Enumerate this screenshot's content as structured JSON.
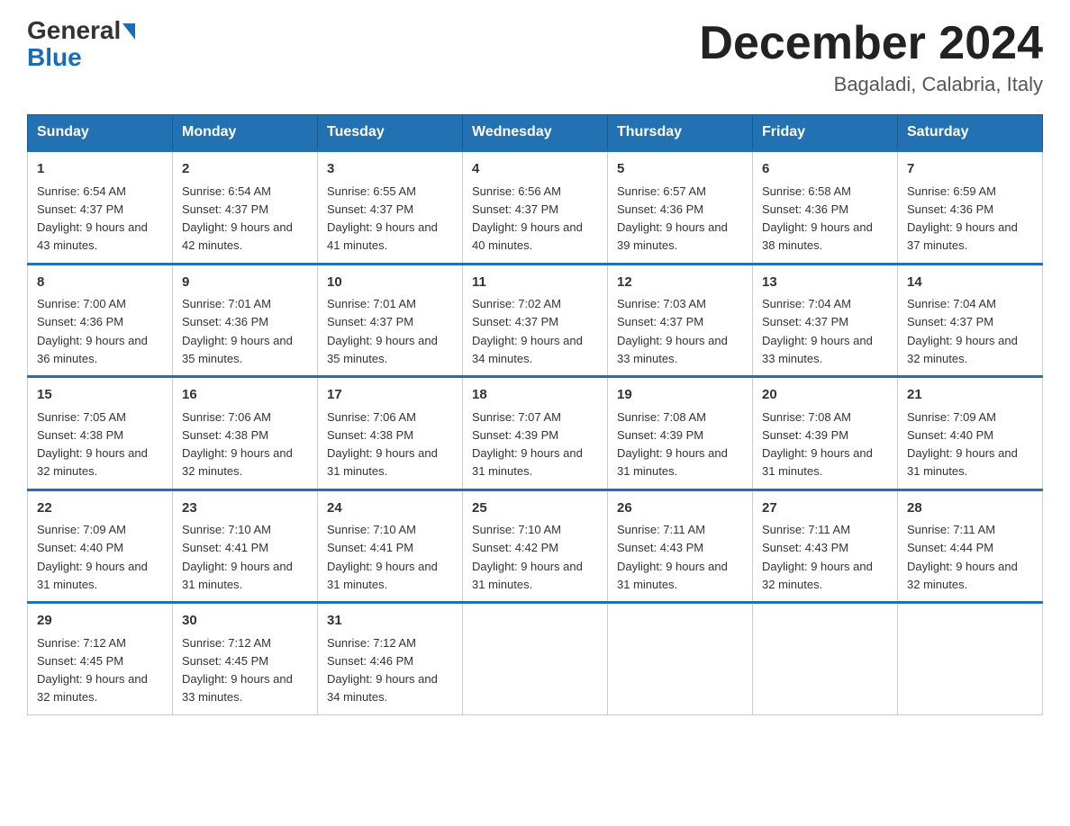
{
  "header": {
    "logo_general": "General",
    "logo_blue": "Blue",
    "title": "December 2024",
    "location": "Bagaladi, Calabria, Italy"
  },
  "days_of_week": [
    "Sunday",
    "Monday",
    "Tuesday",
    "Wednesday",
    "Thursday",
    "Friday",
    "Saturday"
  ],
  "weeks": [
    [
      {
        "day": "1",
        "sunrise": "6:54 AM",
        "sunset": "4:37 PM",
        "daylight": "9 hours and 43 minutes."
      },
      {
        "day": "2",
        "sunrise": "6:54 AM",
        "sunset": "4:37 PM",
        "daylight": "9 hours and 42 minutes."
      },
      {
        "day": "3",
        "sunrise": "6:55 AM",
        "sunset": "4:37 PM",
        "daylight": "9 hours and 41 minutes."
      },
      {
        "day": "4",
        "sunrise": "6:56 AM",
        "sunset": "4:37 PM",
        "daylight": "9 hours and 40 minutes."
      },
      {
        "day": "5",
        "sunrise": "6:57 AM",
        "sunset": "4:36 PM",
        "daylight": "9 hours and 39 minutes."
      },
      {
        "day": "6",
        "sunrise": "6:58 AM",
        "sunset": "4:36 PM",
        "daylight": "9 hours and 38 minutes."
      },
      {
        "day": "7",
        "sunrise": "6:59 AM",
        "sunset": "4:36 PM",
        "daylight": "9 hours and 37 minutes."
      }
    ],
    [
      {
        "day": "8",
        "sunrise": "7:00 AM",
        "sunset": "4:36 PM",
        "daylight": "9 hours and 36 minutes."
      },
      {
        "day": "9",
        "sunrise": "7:01 AM",
        "sunset": "4:36 PM",
        "daylight": "9 hours and 35 minutes."
      },
      {
        "day": "10",
        "sunrise": "7:01 AM",
        "sunset": "4:37 PM",
        "daylight": "9 hours and 35 minutes."
      },
      {
        "day": "11",
        "sunrise": "7:02 AM",
        "sunset": "4:37 PM",
        "daylight": "9 hours and 34 minutes."
      },
      {
        "day": "12",
        "sunrise": "7:03 AM",
        "sunset": "4:37 PM",
        "daylight": "9 hours and 33 minutes."
      },
      {
        "day": "13",
        "sunrise": "7:04 AM",
        "sunset": "4:37 PM",
        "daylight": "9 hours and 33 minutes."
      },
      {
        "day": "14",
        "sunrise": "7:04 AM",
        "sunset": "4:37 PM",
        "daylight": "9 hours and 32 minutes."
      }
    ],
    [
      {
        "day": "15",
        "sunrise": "7:05 AM",
        "sunset": "4:38 PM",
        "daylight": "9 hours and 32 minutes."
      },
      {
        "day": "16",
        "sunrise": "7:06 AM",
        "sunset": "4:38 PM",
        "daylight": "9 hours and 32 minutes."
      },
      {
        "day": "17",
        "sunrise": "7:06 AM",
        "sunset": "4:38 PM",
        "daylight": "9 hours and 31 minutes."
      },
      {
        "day": "18",
        "sunrise": "7:07 AM",
        "sunset": "4:39 PM",
        "daylight": "9 hours and 31 minutes."
      },
      {
        "day": "19",
        "sunrise": "7:08 AM",
        "sunset": "4:39 PM",
        "daylight": "9 hours and 31 minutes."
      },
      {
        "day": "20",
        "sunrise": "7:08 AM",
        "sunset": "4:39 PM",
        "daylight": "9 hours and 31 minutes."
      },
      {
        "day": "21",
        "sunrise": "7:09 AM",
        "sunset": "4:40 PM",
        "daylight": "9 hours and 31 minutes."
      }
    ],
    [
      {
        "day": "22",
        "sunrise": "7:09 AM",
        "sunset": "4:40 PM",
        "daylight": "9 hours and 31 minutes."
      },
      {
        "day": "23",
        "sunrise": "7:10 AM",
        "sunset": "4:41 PM",
        "daylight": "9 hours and 31 minutes."
      },
      {
        "day": "24",
        "sunrise": "7:10 AM",
        "sunset": "4:41 PM",
        "daylight": "9 hours and 31 minutes."
      },
      {
        "day": "25",
        "sunrise": "7:10 AM",
        "sunset": "4:42 PM",
        "daylight": "9 hours and 31 minutes."
      },
      {
        "day": "26",
        "sunrise": "7:11 AM",
        "sunset": "4:43 PM",
        "daylight": "9 hours and 31 minutes."
      },
      {
        "day": "27",
        "sunrise": "7:11 AM",
        "sunset": "4:43 PM",
        "daylight": "9 hours and 32 minutes."
      },
      {
        "day": "28",
        "sunrise": "7:11 AM",
        "sunset": "4:44 PM",
        "daylight": "9 hours and 32 minutes."
      }
    ],
    [
      {
        "day": "29",
        "sunrise": "7:12 AM",
        "sunset": "4:45 PM",
        "daylight": "9 hours and 32 minutes."
      },
      {
        "day": "30",
        "sunrise": "7:12 AM",
        "sunset": "4:45 PM",
        "daylight": "9 hours and 33 minutes."
      },
      {
        "day": "31",
        "sunrise": "7:12 AM",
        "sunset": "4:46 PM",
        "daylight": "9 hours and 34 minutes."
      },
      null,
      null,
      null,
      null
    ]
  ]
}
